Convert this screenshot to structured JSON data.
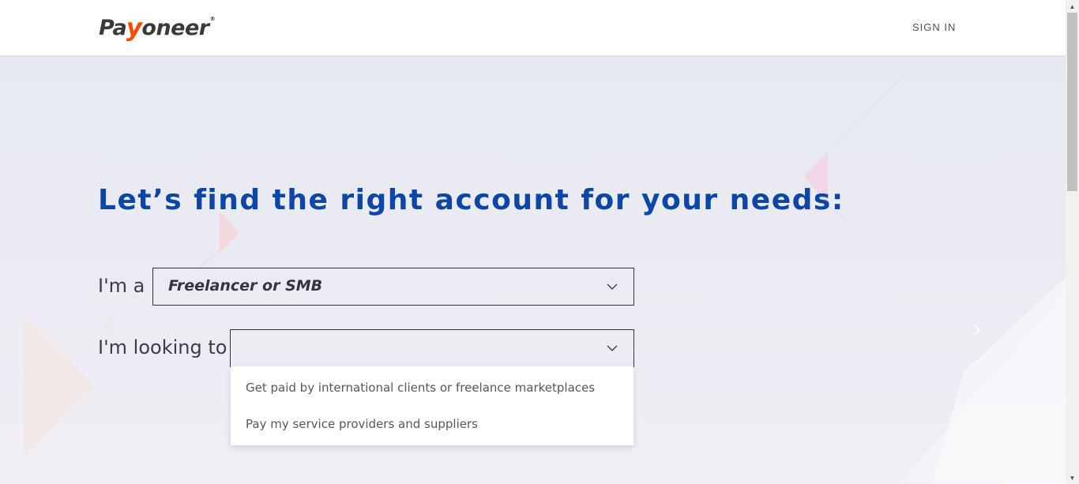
{
  "header": {
    "logo": {
      "pre": "Pa",
      "y": "y",
      "post": "oneer",
      "reg": "®"
    },
    "signin_label": "SIGN IN"
  },
  "hero": {
    "headline": "Let’s find the right account for your needs:",
    "row1": {
      "label": "I'm a",
      "value": "Freelancer or SMB"
    },
    "row2": {
      "label": "I'm looking to",
      "value": ""
    },
    "dropdown_options": [
      "Get paid by international clients or freelance marketplaces",
      "Pay my service providers and suppliers"
    ]
  },
  "colors": {
    "headline": "#0b46a8",
    "logo_accent": "#ff4800",
    "text_dark": "#33343c"
  },
  "scrollbar": {
    "up_icon": "▲",
    "down_icon": "▼"
  }
}
